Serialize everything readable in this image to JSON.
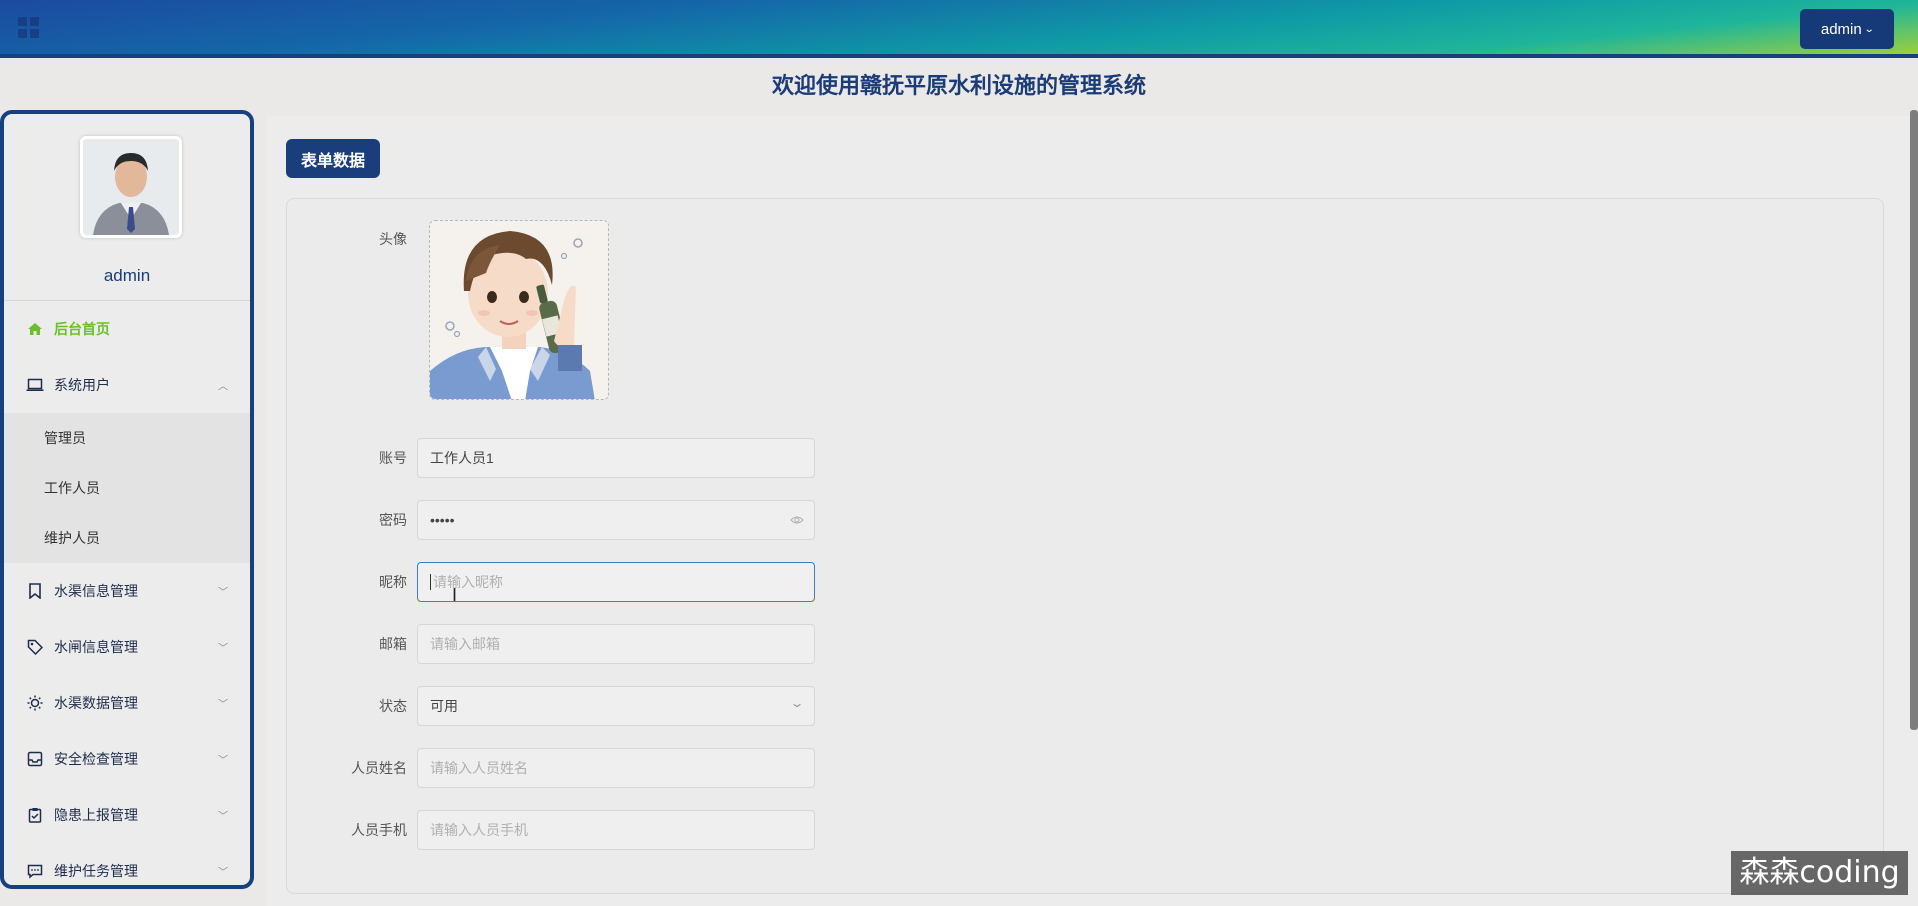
{
  "header": {
    "user_button_label": "admin"
  },
  "welcome_title": "欢迎使用赣抚平原水利设施的管理系统",
  "sidebar": {
    "username": "admin",
    "menu": [
      {
        "label": "后台首页",
        "icon": "home-icon",
        "active": true
      },
      {
        "label": "系统用户",
        "icon": "laptop-icon",
        "expanded": true
      },
      {
        "label": "水渠信息管理",
        "icon": "bookmark-icon"
      },
      {
        "label": "水闸信息管理",
        "icon": "tag-icon"
      },
      {
        "label": "水渠数据管理",
        "icon": "sun-icon"
      },
      {
        "label": "安全检查管理",
        "icon": "inbox-icon"
      },
      {
        "label": "隐患上报管理",
        "icon": "clipboard-icon"
      },
      {
        "label": "维护任务管理",
        "icon": "message-icon"
      }
    ],
    "submenu": [
      "管理员",
      "工作人员",
      "维护人员"
    ]
  },
  "main": {
    "section_button": "表单数据",
    "form": {
      "avatar_label": "头像",
      "account": {
        "label": "账号",
        "value": "工作人员1"
      },
      "password": {
        "label": "密码",
        "value": "•••••"
      },
      "nickname": {
        "label": "昵称",
        "placeholder": "请输入昵称"
      },
      "email": {
        "label": "邮箱",
        "placeholder": "请输入邮箱"
      },
      "status": {
        "label": "状态",
        "value": "可用"
      },
      "person_name": {
        "label": "人员姓名",
        "placeholder": "请输入人员姓名"
      },
      "person_phone": {
        "label": "人员手机",
        "placeholder": "请输入人员手机"
      }
    }
  },
  "watermark": "森森coding",
  "colors": {
    "primary": "#1a3e7c",
    "active_menu": "#6dbf2a",
    "focus_border": "#3d7ec4"
  }
}
